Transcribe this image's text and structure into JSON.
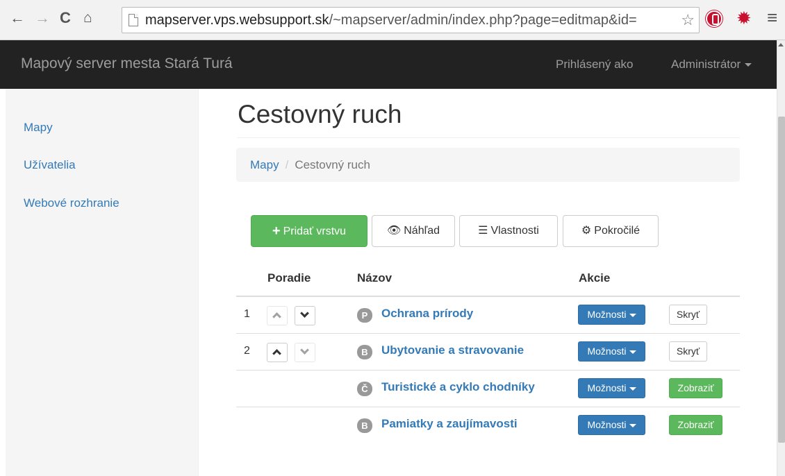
{
  "browser": {
    "url_host": "mapserver.vps.websupport.sk",
    "url_path": "/~mapserver/admin/index.php?page=editmap&id="
  },
  "navbar": {
    "brand": "Mapový server mesta Stará Turá",
    "logged_in_label": "Prihlásený ako",
    "user_name": "Administrátor"
  },
  "sidebar": {
    "items": [
      {
        "label": "Mapy"
      },
      {
        "label": "Užívatelia"
      },
      {
        "label": "Webové rozhranie"
      }
    ]
  },
  "page": {
    "title": "Cestovný ruch",
    "breadcrumb": {
      "root": "Mapy",
      "current": "Cestovný ruch"
    }
  },
  "toolbar": {
    "add_layer_label": "Pridať vrstvu",
    "preview_label": "Náhľad",
    "properties_label": "Vlastnosti",
    "advanced_label": "Pokročilé"
  },
  "table": {
    "headers": {
      "order": "Poradie",
      "name": "Názov",
      "actions": "Akcie"
    },
    "rows": [
      {
        "num": "1",
        "badge": "P",
        "name": "Ochrana prírody",
        "options_label": "Možnosti",
        "toggle_label": "Skryť",
        "visible": true
      },
      {
        "num": "2",
        "badge": "B",
        "name": "Ubytovanie a stravovanie",
        "options_label": "Možnosti",
        "toggle_label": "Skryť",
        "visible": true
      },
      {
        "num": "",
        "badge": "Č",
        "name": "Turistické a cyklo chodníky",
        "options_label": "Možnosti",
        "toggle_label": "Zobraziť",
        "visible": false
      },
      {
        "num": "",
        "badge": "B",
        "name": "Pamiatky a zaujímavosti",
        "options_label": "Možnosti",
        "toggle_label": "Zobraziť",
        "visible": false
      }
    ]
  },
  "colors": {
    "primary": "#337ab7",
    "success": "#5cb85c",
    "navbar": "#222222"
  }
}
